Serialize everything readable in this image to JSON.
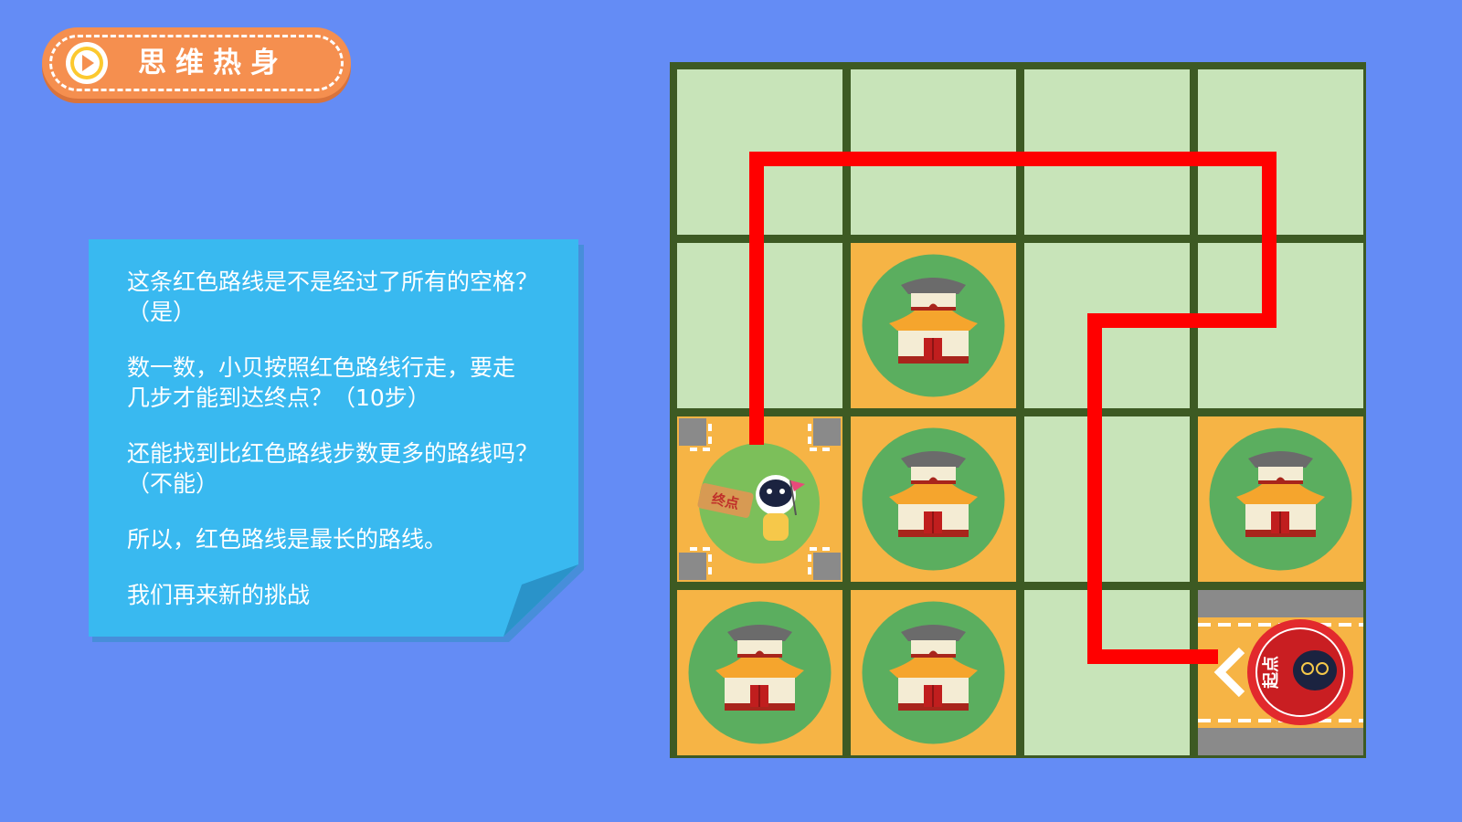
{
  "header": {
    "title": "思维热身",
    "icon": "play-icon",
    "color": "#f58f4f"
  },
  "note": {
    "color": "#39b9f0",
    "paragraphs": [
      "这条红色路线是不是经过了所有的空格？\n（是）",
      "数一数，小贝按照红色路线行走，要走\n几步才能到达终点？（10步）",
      "还能找到比红色路线步数更多的路线吗？\n（不能）",
      "所以，红色路线是最长的路线。",
      "我们再来新的挑战"
    ]
  },
  "board": {
    "rows": 4,
    "cols": 4,
    "grid_color": "#3d5a23",
    "empty_color": "#c8e4b9",
    "blocked_color": "#f6b445",
    "route_color": "#ff0000",
    "end_label": "终点",
    "start_label": "起点",
    "cells": [
      [
        "empty",
        "empty",
        "empty",
        "empty"
      ],
      [
        "empty",
        "temple",
        "empty",
        "empty"
      ],
      [
        "end",
        "temple",
        "empty",
        "temple"
      ],
      [
        "temple",
        "temple",
        "empty",
        "start"
      ]
    ]
  }
}
